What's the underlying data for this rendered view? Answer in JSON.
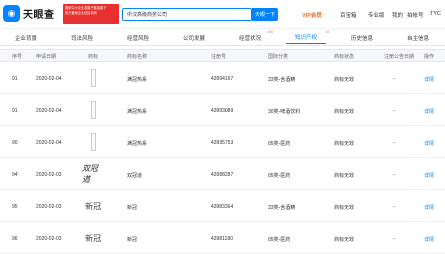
{
  "header": {
    "logo_text": "天眼查",
    "banner_lines": [
      "国家中小企业发展子基金旗下",
      "官方备案企业征信机构"
    ],
    "search_value": "中汉高级商务公司",
    "search_button": "天眼一下",
    "vip_label": "VIP会员",
    "nav": [
      "百宝箱",
      "专业版",
      "我的",
      "拍帐号",
      "TYC"
    ]
  },
  "tabs": [
    {
      "label": "企业背景",
      "sup": ""
    },
    {
      "label": "司法风险",
      "sup": ""
    },
    {
      "label": "经营风险",
      "sup": ""
    },
    {
      "label": "公司发展",
      "sup": ""
    },
    {
      "label": "经营状况",
      "sup": "305"
    },
    {
      "label": "知识产权",
      "sup": "19",
      "active": true
    },
    {
      "label": "历史信息",
      "sup": ""
    },
    {
      "label": "自主信息",
      "sup": ""
    }
  ],
  "table": {
    "headers": [
      "序号",
      "申请日期",
      "商标",
      "商标名称",
      "注册号",
      "国际分类",
      "商标状态",
      "注册公告日期",
      "操作"
    ],
    "rows": [
      {
        "index": "91",
        "date": "2020-02-04",
        "thumb": "box",
        "name": "满冠热系",
        "reg_no": "43994167",
        "class": "33类-含酒精",
        "status": "商标无效",
        "pub_date": "-",
        "action": "详情"
      },
      {
        "index": "91",
        "date": "2020-02-04",
        "thumb": "box",
        "name": "满冠热系",
        "reg_no": "43993089",
        "class": "30类-啤酒饮料",
        "status": "商标无效",
        "pub_date": "-",
        "action": "详情"
      },
      {
        "index": "90",
        "date": "2020-02-04",
        "thumb": "box",
        "name": "满冠热系",
        "reg_no": "43995753",
        "class": "05类-医药",
        "status": "商标无效",
        "pub_date": "-",
        "action": "详情"
      },
      {
        "index": "94",
        "date": "2020-02-03",
        "thumb": "stylized",
        "thumb_text": "双冠道",
        "name": "双冠道",
        "reg_no": "43988287",
        "class": "05类-医药",
        "status": "商标无效",
        "pub_date": "-",
        "action": "详情"
      },
      {
        "index": "95",
        "date": "2020-02-03",
        "thumb": "plain",
        "thumb_text": "新冠",
        "name": "新冠",
        "reg_no": "43983364",
        "class": "33类-含酒精",
        "status": "商标无效",
        "pub_date": "-",
        "action": "详情"
      },
      {
        "index": "96",
        "date": "2020-02-03",
        "thumb": "plain",
        "thumb_text": "新冠",
        "name": "新冠",
        "reg_no": "43981180",
        "class": "05类-医药",
        "status": "商标无效",
        "pub_date": "-",
        "action": "详情"
      }
    ]
  }
}
